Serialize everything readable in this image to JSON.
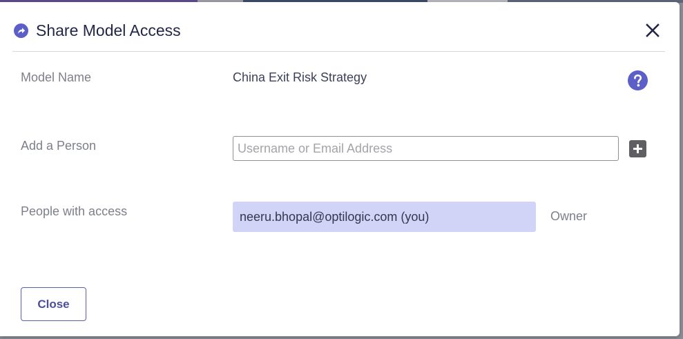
{
  "dialog": {
    "title": "Share Model Access",
    "title_icon": "share-icon",
    "close_icon": "close-icon"
  },
  "model": {
    "label": "Model Name",
    "value": "China Exit Risk Strategy",
    "help_icon": "help-icon"
  },
  "add_person": {
    "label": "Add a Person",
    "input_value": "",
    "placeholder": "Username or Email Address",
    "add_icon": "plus-icon"
  },
  "access": {
    "label": "People with access",
    "people": [
      {
        "name": "neeru.bhopal@optilogic.com (you)",
        "role": "Owner"
      }
    ]
  },
  "footer": {
    "close_label": "Close"
  },
  "colors": {
    "accent": "#5b5fc7",
    "chip_bg": "#d1d4f7",
    "title_text": "#222748"
  }
}
